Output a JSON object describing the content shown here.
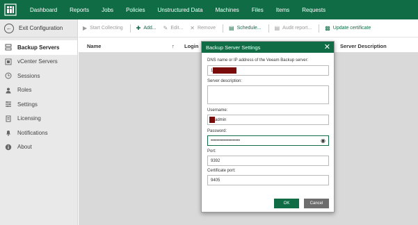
{
  "nav": {
    "items": [
      "Dashboard",
      "Reports",
      "Jobs",
      "Policies",
      "Unstructured Data",
      "Machines",
      "Files",
      "Items",
      "Requests"
    ]
  },
  "sidebar": {
    "exit_label": "Exit Configuration",
    "items": [
      {
        "label": "Backup Servers",
        "icon": "backup-server-icon",
        "active": true
      },
      {
        "label": "vCenter Servers",
        "icon": "vcenter-icon"
      },
      {
        "label": "Sessions",
        "icon": "sessions-icon"
      },
      {
        "label": "Roles",
        "icon": "roles-icon"
      },
      {
        "label": "Settings",
        "icon": "settings-icon"
      },
      {
        "label": "Licensing",
        "icon": "licensing-icon"
      },
      {
        "label": "Notifications",
        "icon": "notifications-icon"
      },
      {
        "label": "About",
        "icon": "about-icon"
      }
    ]
  },
  "toolbar": {
    "start_collecting": "Start Collecting",
    "add": "Add...",
    "edit": "Edit...",
    "remove": "Remove",
    "schedule": "Schedule...",
    "audit_report": "Audit report...",
    "update_certificate": "Update certificate"
  },
  "table": {
    "headers": {
      "name": "Name",
      "login": "Login",
      "server_description": "Server Description"
    }
  },
  "dialog": {
    "title": "Backup Server Settings",
    "dns_label": "DNS name or IP address of the Veeam Backup server:",
    "dns_value": "1",
    "description_label": "Server description:",
    "description_value": "",
    "username_label": "Username:",
    "username_value": "admin",
    "password_label": "Password:",
    "password_value": "••••••••••••••••••••",
    "port_label": "Port:",
    "port_value": "9392",
    "cert_port_label": "Certificate port:",
    "cert_port_value": "9405",
    "ok": "OK",
    "cancel": "Cancel"
  },
  "colors": {
    "brand": "#0f6c45",
    "cancel": "#6d6d6d",
    "redaction": "#7a0b0b"
  }
}
